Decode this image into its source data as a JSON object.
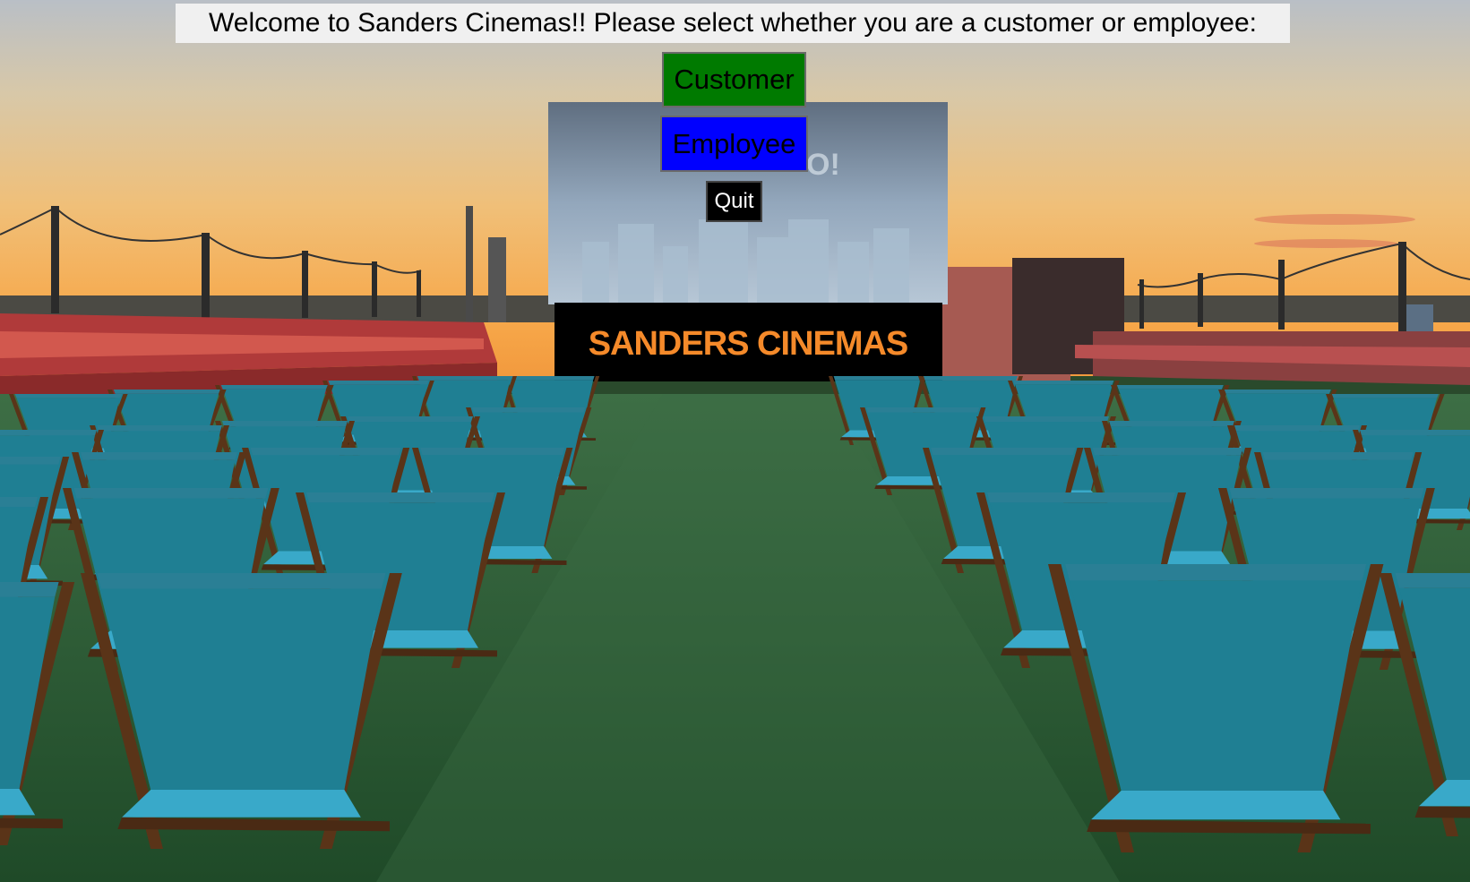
{
  "welcome_text": "Welcome to Sanders Cinemas!! Please select whether you are a customer or employee:",
  "buttons": {
    "customer": "Customer",
    "employee": "Employee",
    "quit": "Quit"
  },
  "logo": {
    "text": "SANDERS CINEMAS",
    "color": "#f58a2a"
  },
  "colors": {
    "customer_bg": "#007a00",
    "employee_bg": "#0000ff",
    "quit_bg": "#000000",
    "seat_fabric": "#1f7f93",
    "turf": "#2a5a32"
  }
}
